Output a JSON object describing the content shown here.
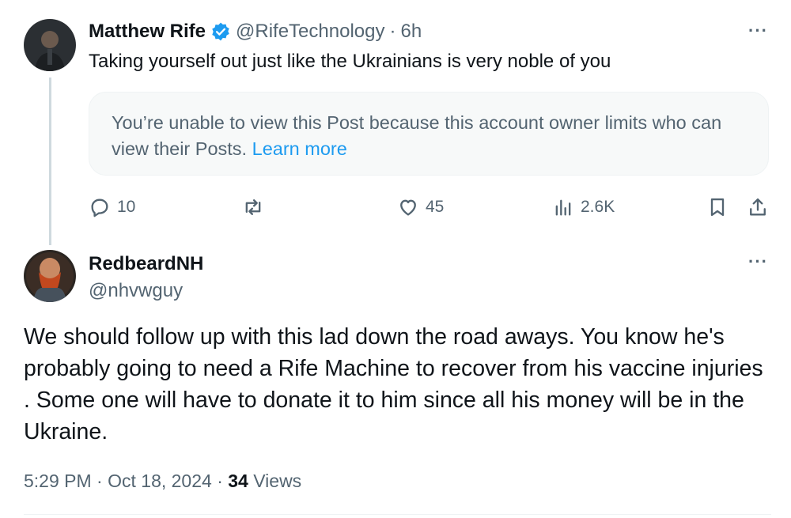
{
  "parent_post": {
    "author_name": "Matthew Rife",
    "verified_icon": "verified-badge-icon",
    "handle": "@RifeTechnology",
    "separator": "·",
    "time_ago": "6h",
    "text": "Taking yourself out just like the Ukrainians is very noble of you",
    "notice": {
      "text": "You’re unable to view this Post because this account owner limits who can view their Posts.",
      "link": "Learn more"
    },
    "actions": {
      "replies": "10",
      "reposts": "",
      "likes": "45",
      "views": "2.6K"
    },
    "more_label": "···"
  },
  "reply_post": {
    "author_name": "RedbeardNH",
    "handle": "@nhvwguy",
    "text": "We should follow up with this lad down the road aways.  You know he's probably going to need a Rife Machine to recover from his vaccine injuries .  Some one will have to donate it to him since all his money will be in the Ukraine.",
    "time": "5:29 PM",
    "date": "Oct 18, 2024",
    "separator": "·",
    "views_count": "34",
    "views_label": "Views",
    "more_label": "···"
  },
  "colors": {
    "text_primary": "#0f1419",
    "text_secondary": "#536471",
    "link_blue": "#1d9bf0",
    "verified_blue": "#1d9bf0",
    "notice_bg": "#f7f9f9",
    "thread_line": "#cfd9de"
  }
}
